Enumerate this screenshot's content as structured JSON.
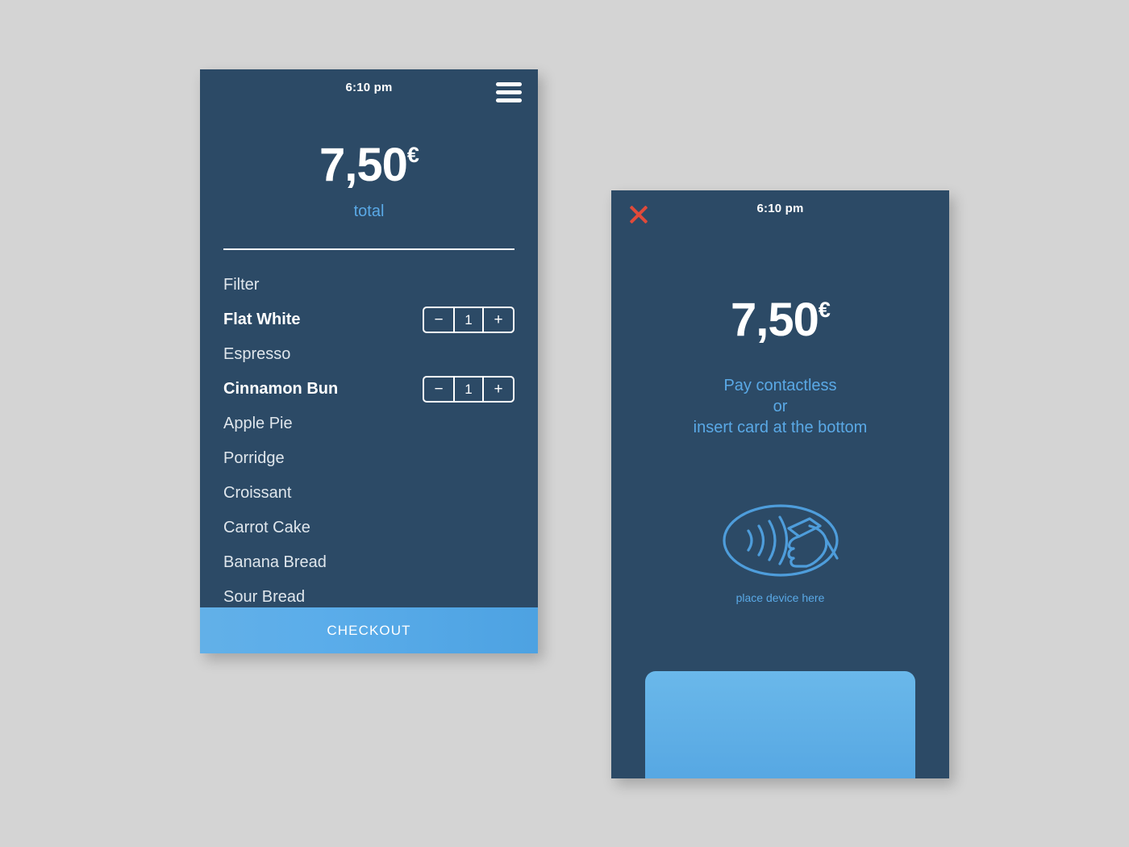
{
  "theme": {
    "panel_bg": "#2c4a66",
    "page_bg": "#d4d4d4",
    "accent_blue": "#5aa9e6",
    "checkout_blue": "#55ace7",
    "close_red": "#e04a3a",
    "text_white": "#ffffff",
    "text_muted": "#dfe6ec"
  },
  "order_screen": {
    "status_time": "6:10 pm",
    "menu_icon": "hamburger-menu-icon",
    "amount": "7,50",
    "currency": "€",
    "total_label": "total",
    "items": [
      {
        "name": "Filter",
        "selected": false,
        "qty": null
      },
      {
        "name": "Flat White",
        "selected": true,
        "qty": "1"
      },
      {
        "name": "Espresso",
        "selected": false,
        "qty": null
      },
      {
        "name": "Cinnamon Bun",
        "selected": true,
        "qty": "1"
      },
      {
        "name": "Apple Pie",
        "selected": false,
        "qty": null
      },
      {
        "name": "Porridge",
        "selected": false,
        "qty": null
      },
      {
        "name": "Croissant",
        "selected": false,
        "qty": null
      },
      {
        "name": "Carrot Cake",
        "selected": false,
        "qty": null
      },
      {
        "name": "Banana Bread",
        "selected": false,
        "qty": null
      },
      {
        "name": "Sour Bread",
        "selected": false,
        "qty": null
      }
    ],
    "stepper": {
      "decrement_label": "−",
      "increment_label": "+"
    },
    "checkout_label": "CHECKOUT"
  },
  "payment_screen": {
    "status_time": "6:10 pm",
    "close_icon": "close-x-icon",
    "amount": "7,50",
    "currency": "€",
    "instruction_line_1": "Pay contactless",
    "instruction_line_2": "or",
    "instruction_line_3": "insert card at the bottom",
    "nfc_icon": "contactless-payment-icon",
    "nfc_caption": "place device here",
    "card_slot": "card-insert-slot"
  }
}
